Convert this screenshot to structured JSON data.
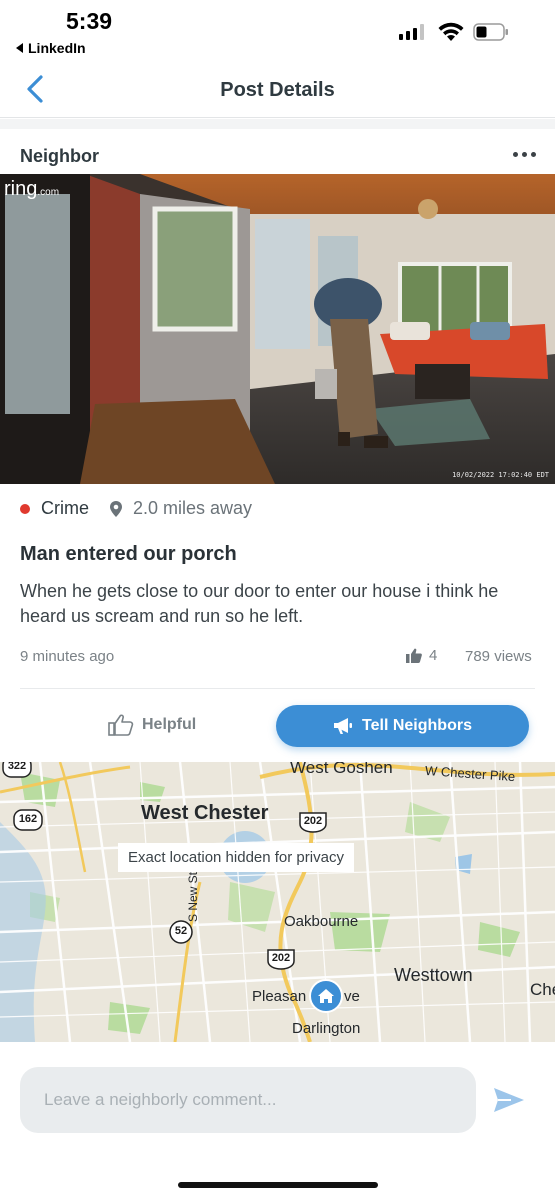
{
  "status_bar": {
    "time": "5:39",
    "back_app": "LinkedIn"
  },
  "nav": {
    "title": "Post Details"
  },
  "post": {
    "author": "Neighbor",
    "video": {
      "brand": "ring",
      "brand_suffix": ".com",
      "timestamp": "10/02/2022 17:02:40 EDT"
    },
    "category": "Crime",
    "category_color": "#e0392e",
    "distance": "2.0 miles away",
    "title": "Man entered our porch",
    "body": "When he gets close to our door to enter our house i think he heard us scream and run so he left.",
    "time_ago": "9 minutes ago",
    "likes": "4",
    "views": "789 views"
  },
  "actions": {
    "helpful": "Helpful",
    "tell_neighbors": "Tell Neighbors",
    "accent_color": "#3c8ed5"
  },
  "map": {
    "privacy_note": "Exact location hidden for privacy",
    "labels": {
      "west_goshen": "West Goshen",
      "w_chester_pike": "W Chester Pike",
      "west_chester": "West Chester",
      "oakbourne": "Oakbourne",
      "westtown": "Westtown",
      "pleasant_grove_left": "Pleasan",
      "pleasant_grove_right": "ve",
      "darlington": "Darlington",
      "s_new_st": "S New St",
      "che": "Che"
    },
    "shields": {
      "r322": "322",
      "r162": "162",
      "r202_top": "202",
      "r52": "52",
      "r202_bottom": "202"
    }
  },
  "comment": {
    "placeholder": "Leave a neighborly comment..."
  }
}
